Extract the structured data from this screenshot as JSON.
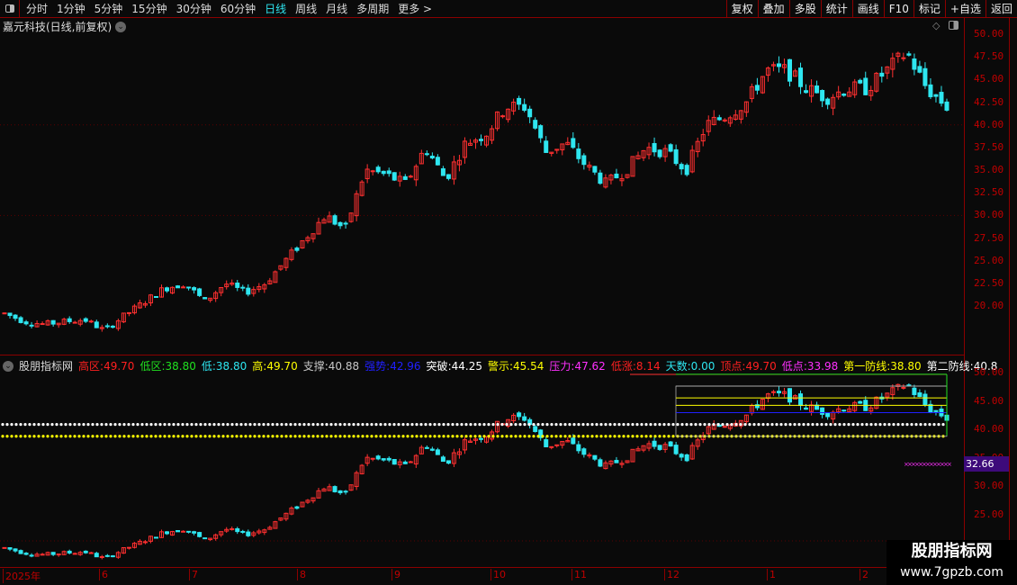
{
  "toolbar": {
    "periods": [
      "分时",
      "1分钟",
      "5分钟",
      "15分钟",
      "30分钟",
      "60分钟",
      "日线",
      "周线",
      "月线",
      "多周期",
      "更多 >"
    ],
    "active_period": "日线",
    "buttons": [
      "复权",
      "叠加",
      "多股",
      "统计",
      "画线",
      "F10",
      "标记",
      "+自选",
      "返回"
    ]
  },
  "main_chart": {
    "title": "嘉元科技(日线,前复权)",
    "y_ticks": [
      "50.00",
      "47.50",
      "45.00",
      "42.50",
      "40.00",
      "37.50",
      "35.00",
      "32.50",
      "30.00",
      "27.50",
      "25.00",
      "22.50",
      "20.00"
    ]
  },
  "indicator": {
    "name": "股朋指标网",
    "items": [
      {
        "label": "高区",
        "value": "49.70",
        "color": "#ff2020"
      },
      {
        "label": "低区",
        "value": "38.80",
        "color": "#20e020"
      },
      {
        "label": "低",
        "value": "38.80",
        "color": "#2ee6f0"
      },
      {
        "label": "高",
        "value": "49.70",
        "color": "#ffff00"
      },
      {
        "label": "支撑",
        "value": "40.88",
        "color": "#c8c8c8"
      },
      {
        "label": "强势",
        "value": "42.96",
        "color": "#2020ff"
      },
      {
        "label": "突破",
        "value": "44.25",
        "color": "#ffffff"
      },
      {
        "label": "警示",
        "value": "45.54",
        "color": "#ffff00"
      },
      {
        "label": "压力",
        "value": "47.62",
        "color": "#ff30ff"
      },
      {
        "label": "低涨",
        "value": "8.14",
        "color": "#ff2020"
      },
      {
        "label": "天数",
        "value": "0.00",
        "color": "#2ee6f0"
      },
      {
        "label": "顶点",
        "value": "49.70",
        "color": "#ff2020"
      },
      {
        "label": "低点",
        "value": "33.98",
        "color": "#ff30ff"
      },
      {
        "label": "第一防线",
        "value": "38.80",
        "color": "#ffff00"
      },
      {
        "label": "第二防线",
        "value": "40.8",
        "color": "#ffffff"
      }
    ],
    "y_ticks": [
      "50.00",
      "45.00",
      "40.00",
      "35.00",
      "30.00",
      "25.00"
    ],
    "current_tag": "32.66"
  },
  "x_axis": {
    "months": [
      "2025年",
      "6",
      "7",
      "8",
      "9",
      "10",
      "11",
      "12",
      "1",
      "2"
    ]
  },
  "watermark": {
    "name": "股朋指标网",
    "url": "www.7gpzb.com"
  },
  "colors": {
    "up": "#ff3030",
    "down": "#2ee6f0",
    "grid": "#8b0000",
    "axis_text": "#c00000"
  },
  "price_path": [
    19.2,
    18.3,
    18,
    18.3,
    18.5,
    17.3,
    19,
    20.5,
    22,
    22.5,
    20.5,
    22.5,
    21.5,
    22.5,
    25,
    27.5,
    30,
    28.5,
    35,
    34.5,
    33.5,
    37.5,
    34,
    38,
    39,
    42,
    42,
    37,
    38,
    35.5,
    33.5,
    35,
    37.5,
    37,
    35,
    40,
    41,
    42.5,
    46,
    46,
    44,
    43,
    44,
    44,
    46,
    48,
    44,
    42
  ]
}
